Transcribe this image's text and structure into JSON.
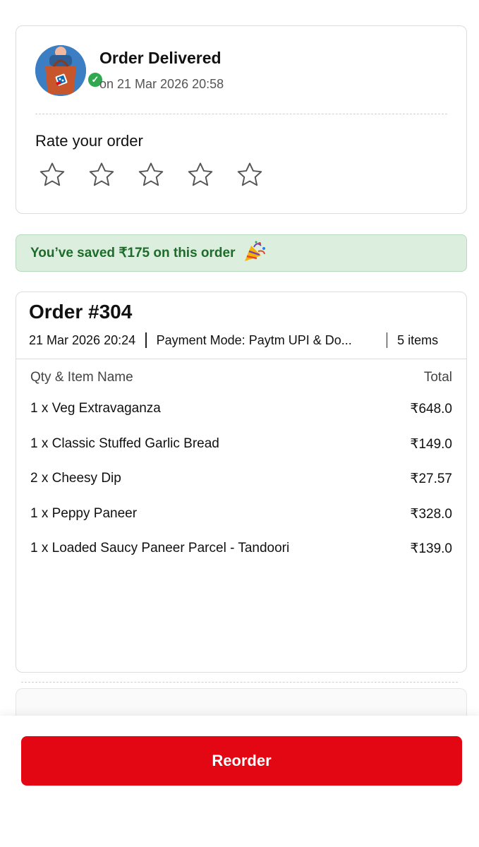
{
  "status": {
    "title": "Order Delivered",
    "time": "on 21 Mar 2026 20:58",
    "avatar_icon": "delivery-bag-icon",
    "badge_icon": "check-icon",
    "badge_color": "#2fa84f"
  },
  "rating": {
    "title": "Rate your order",
    "star_icon": "star-outline-icon",
    "max_stars": 5,
    "selected": 0
  },
  "savings": {
    "text": "You’ve saved ₹175 on this order",
    "icon": "party-popper-icon"
  },
  "order": {
    "title": "Order #304",
    "date": "21 Mar 2026 20:24",
    "payment": "Payment Mode: Paytm UPI & Do...",
    "count": "5 items",
    "col_item": "Qty & Item Name",
    "col_total": "Total",
    "items": [
      {
        "name": "1 x Veg Extravaganza",
        "total": "₹648.0"
      },
      {
        "name": "1 x Classic Stuffed Garlic Bread",
        "total": "₹149.0"
      },
      {
        "name": "2 x Cheesy Dip",
        "total": "₹27.57"
      },
      {
        "name": "1 x Peppy Paneer",
        "total": "₹328.0"
      },
      {
        "name": "1 x Loaded Saucy Paneer Parcel - Tandoori",
        "total": "₹139.0"
      }
    ]
  },
  "reorder_label": "Reorder",
  "colors": {
    "accent": "#e30613",
    "savings_bg": "#dcefdf",
    "savings_text": "#1f6b2b"
  }
}
